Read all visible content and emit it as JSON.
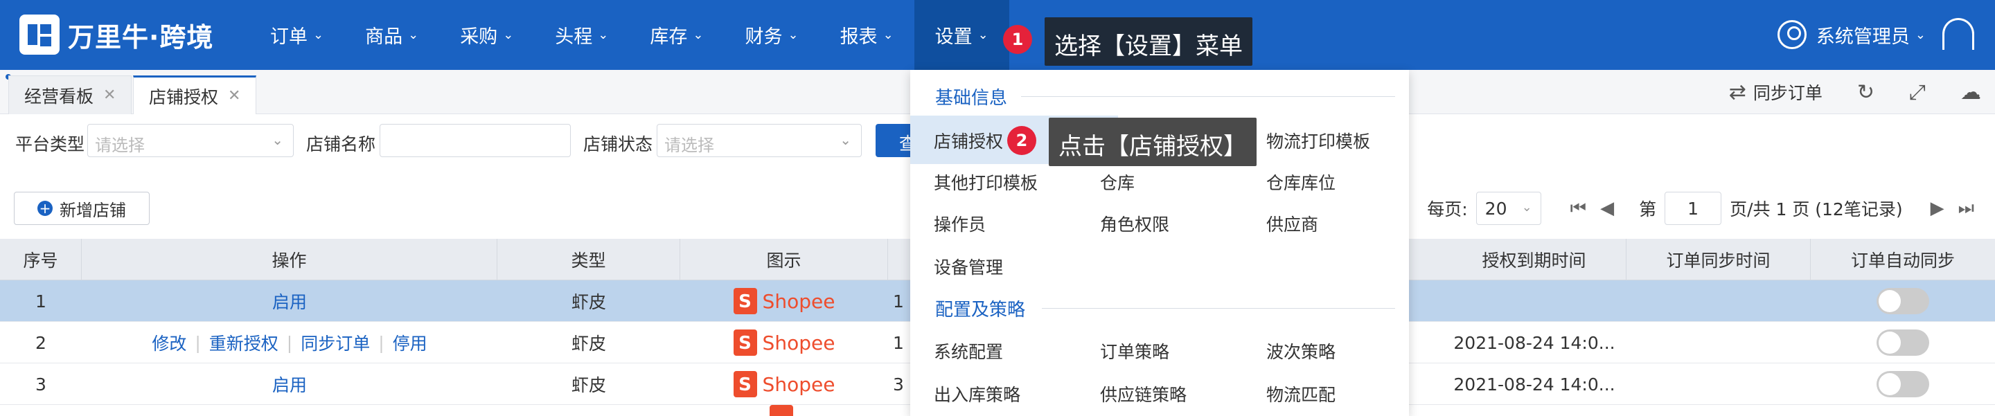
{
  "brand": {
    "name": "万里牛·跨境"
  },
  "nav": {
    "items": [
      "订单",
      "商品",
      "采购",
      "头程",
      "库存",
      "财务",
      "报表",
      "设置"
    ],
    "active_index": 7
  },
  "user": {
    "name": "系统管理员"
  },
  "tabs": [
    {
      "label": "经营看板",
      "active": false
    },
    {
      "label": "店铺授权",
      "active": true
    }
  ],
  "toolbar": {
    "sync_label": "同步订单"
  },
  "filters": {
    "platform_label": "平台类型",
    "platform_placeholder": "请选择",
    "store_name_label": "店铺名称",
    "store_status_label": "店铺状态",
    "store_status_placeholder": "请选择",
    "query_label": "查"
  },
  "actions": {
    "add_store": "新增店铺"
  },
  "pager": {
    "per_page_label": "每页:",
    "per_page_value": "20",
    "page_prefix": "第",
    "page_value": "1",
    "page_suffix": "页/共 1 页 (12笔记录)"
  },
  "table": {
    "headers": {
      "index": "序号",
      "ops": "操作",
      "type": "类型",
      "logo": "图示",
      "expire": "授权到期时间",
      "sync_time": "订单同步时间",
      "auto_sync": "订单自动同步"
    },
    "rows": [
      {
        "index": "1",
        "ops": [
          "启用"
        ],
        "type": "虾皮",
        "brand": "Shopee",
        "col5": "1",
        "expire": "",
        "selected": true
      },
      {
        "index": "2",
        "ops": [
          "修改",
          "重新授权",
          "同步订单",
          "停用"
        ],
        "type": "虾皮",
        "brand": "Shopee",
        "col5": "1",
        "expire": "2021-08-24 14:0...",
        "selected": false
      },
      {
        "index": "3",
        "ops": [
          "启用"
        ],
        "type": "虾皮",
        "brand": "Shopee",
        "col5": "3",
        "expire": "2021-08-24 14:0...",
        "selected": false
      }
    ]
  },
  "menu": {
    "section1": "基础信息",
    "section2": "配置及策略",
    "items_basic": [
      [
        "店铺授权",
        "",
        "物流打印模板"
      ],
      [
        "其他打印模板",
        "仓库",
        "仓库库位"
      ],
      [
        "操作员",
        "角色权限",
        "供应商"
      ],
      [
        "设备管理",
        "",
        ""
      ]
    ],
    "items_config": [
      [
        "系统配置",
        "订单策略",
        "波次策略"
      ],
      [
        "出入库策略",
        "供应链策略",
        "物流匹配"
      ]
    ]
  },
  "guide": {
    "step1_num": "1",
    "step1_text": "选择【设置】菜单",
    "step2_num": "2",
    "step2_text": "点击【店铺授权】"
  },
  "colors": {
    "primary": "#1a62c2",
    "shopee": "#ee4d2d",
    "step": "#e5223a"
  }
}
